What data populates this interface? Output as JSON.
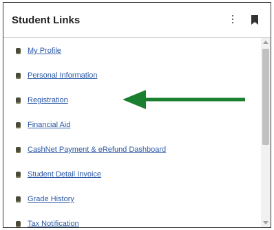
{
  "panel": {
    "title": "Student Links"
  },
  "icons": {
    "menu": "kebab-menu-icon",
    "bookmark": "bookmark-icon",
    "bullet": "bullet-icon",
    "annotation": "arrow-left-icon"
  },
  "links": [
    {
      "label": "My Profile"
    },
    {
      "label": "Personal Information"
    },
    {
      "label": "Registration"
    },
    {
      "label": "Financial Aid"
    },
    {
      "label": "CashNet Payment & eRefund Dashboard"
    },
    {
      "label": "Student Detail Invoice"
    },
    {
      "label": "Grade History"
    },
    {
      "label": "Tax Notification"
    }
  ],
  "colors": {
    "link": "#2a57a6",
    "arrow": "#1a7f2e",
    "border": "#333333"
  }
}
